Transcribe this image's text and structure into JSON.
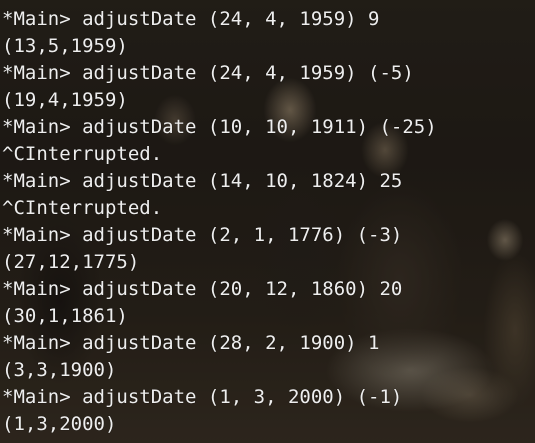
{
  "terminal": {
    "lines": [
      "*Main> adjustDate (24, 4, 1959) 9",
      "(13,5,1959)",
      "*Main> adjustDate (24, 4, 1959) (-5)",
      "(19,4,1959)",
      "*Main> adjustDate (10, 10, 1911) (-25)",
      "^CInterrupted.",
      "*Main> adjustDate (14, 10, 1824) 25",
      "^CInterrupted.",
      "*Main> adjustDate (2, 1, 1776) (-3)",
      "(27,12,1775)",
      "*Main> adjustDate (20, 12, 1860) 20",
      "(30,1,1861)",
      "*Main> adjustDate (28, 2, 1900) 1",
      "(3,3,1900)",
      "*Main> adjustDate (1, 3, 2000) (-1)",
      "(1,3,2000)"
    ]
  },
  "colors": {
    "text": "#eeeeee",
    "background": "#241e19"
  }
}
